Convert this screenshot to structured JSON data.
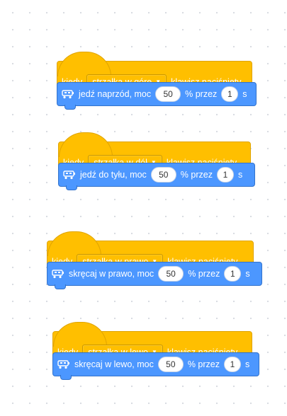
{
  "colors": {
    "event": "#ffbf00",
    "motion": "#4c97ff",
    "canvas_dot": "#d9dce2"
  },
  "scripts": [
    {
      "hat": {
        "when": "kiedy",
        "key": "strzałka w górę",
        "suffix": "klawisz naciśnięty"
      },
      "command": {
        "icon": "robot-icon",
        "label": "jedź naprzód, moc",
        "power": "50",
        "mid": "% przez",
        "duration": "1",
        "unit": "s"
      }
    },
    {
      "hat": {
        "when": "kiedy",
        "key": "strzałka w dół",
        "suffix": "klawisz naciśnięty"
      },
      "command": {
        "icon": "robot-icon",
        "label": "jedź do tyłu, moc",
        "power": "50",
        "mid": "% przez",
        "duration": "1",
        "unit": "s"
      }
    },
    {
      "hat": {
        "when": "kiedy",
        "key": "strzałka w prawo",
        "suffix": "klawisz naciśnięty"
      },
      "command": {
        "icon": "robot-icon",
        "label": "skręcaj w prawo, moc",
        "power": "50",
        "mid": "% przez",
        "duration": "1",
        "unit": "s"
      }
    },
    {
      "hat": {
        "when": "kiedy",
        "key": "strzałka w lewo",
        "suffix": "klawisz naciśnięty"
      },
      "command": {
        "icon": "robot-icon",
        "label": "skręcaj w lewo, moc",
        "power": "50",
        "mid": "% przez",
        "duration": "1",
        "unit": "s"
      }
    }
  ]
}
